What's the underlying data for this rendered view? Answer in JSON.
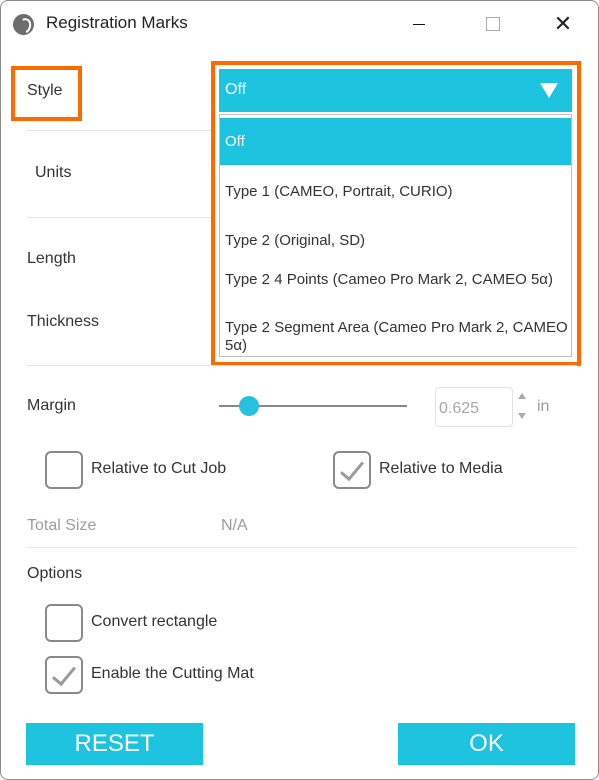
{
  "window": {
    "title": "Registration Marks",
    "controls": {
      "minimize": "—",
      "maximize": "☐",
      "close": "✕"
    }
  },
  "style": {
    "label": "Style",
    "selected": "Off",
    "options": [
      "Off",
      "Type 1 (CAMEO, Portrait, CURIO)",
      "Type 2 (Original, SD)",
      "Type 2 4 Points (Cameo Pro Mark 2, CAMEO 5α)",
      "Type 2 Segment Area (Cameo Pro Mark 2, CAMEO 5α)"
    ]
  },
  "units": {
    "label": "Units"
  },
  "length": {
    "label": "Length"
  },
  "thickness": {
    "label": "Thickness"
  },
  "margin": {
    "label": "Margin",
    "value": "0.625",
    "unit": "in",
    "slider_fraction": 0.16
  },
  "relative_cut_job": {
    "label": "Relative to Cut Job",
    "checked": false
  },
  "relative_media": {
    "label": "Relative to Media",
    "checked": true
  },
  "total_size": {
    "label": "Total Size",
    "value": "N/A"
  },
  "options": {
    "label": "Options",
    "convert_rectangle": {
      "label": "Convert rectangle",
      "checked": false
    },
    "enable_cutting_mat": {
      "label": "Enable the Cutting Mat",
      "checked": true
    }
  },
  "buttons": {
    "reset": "RESET",
    "ok": "OK"
  },
  "colors": {
    "accent": "#1ec3e0",
    "highlight": "#ff6a00"
  }
}
